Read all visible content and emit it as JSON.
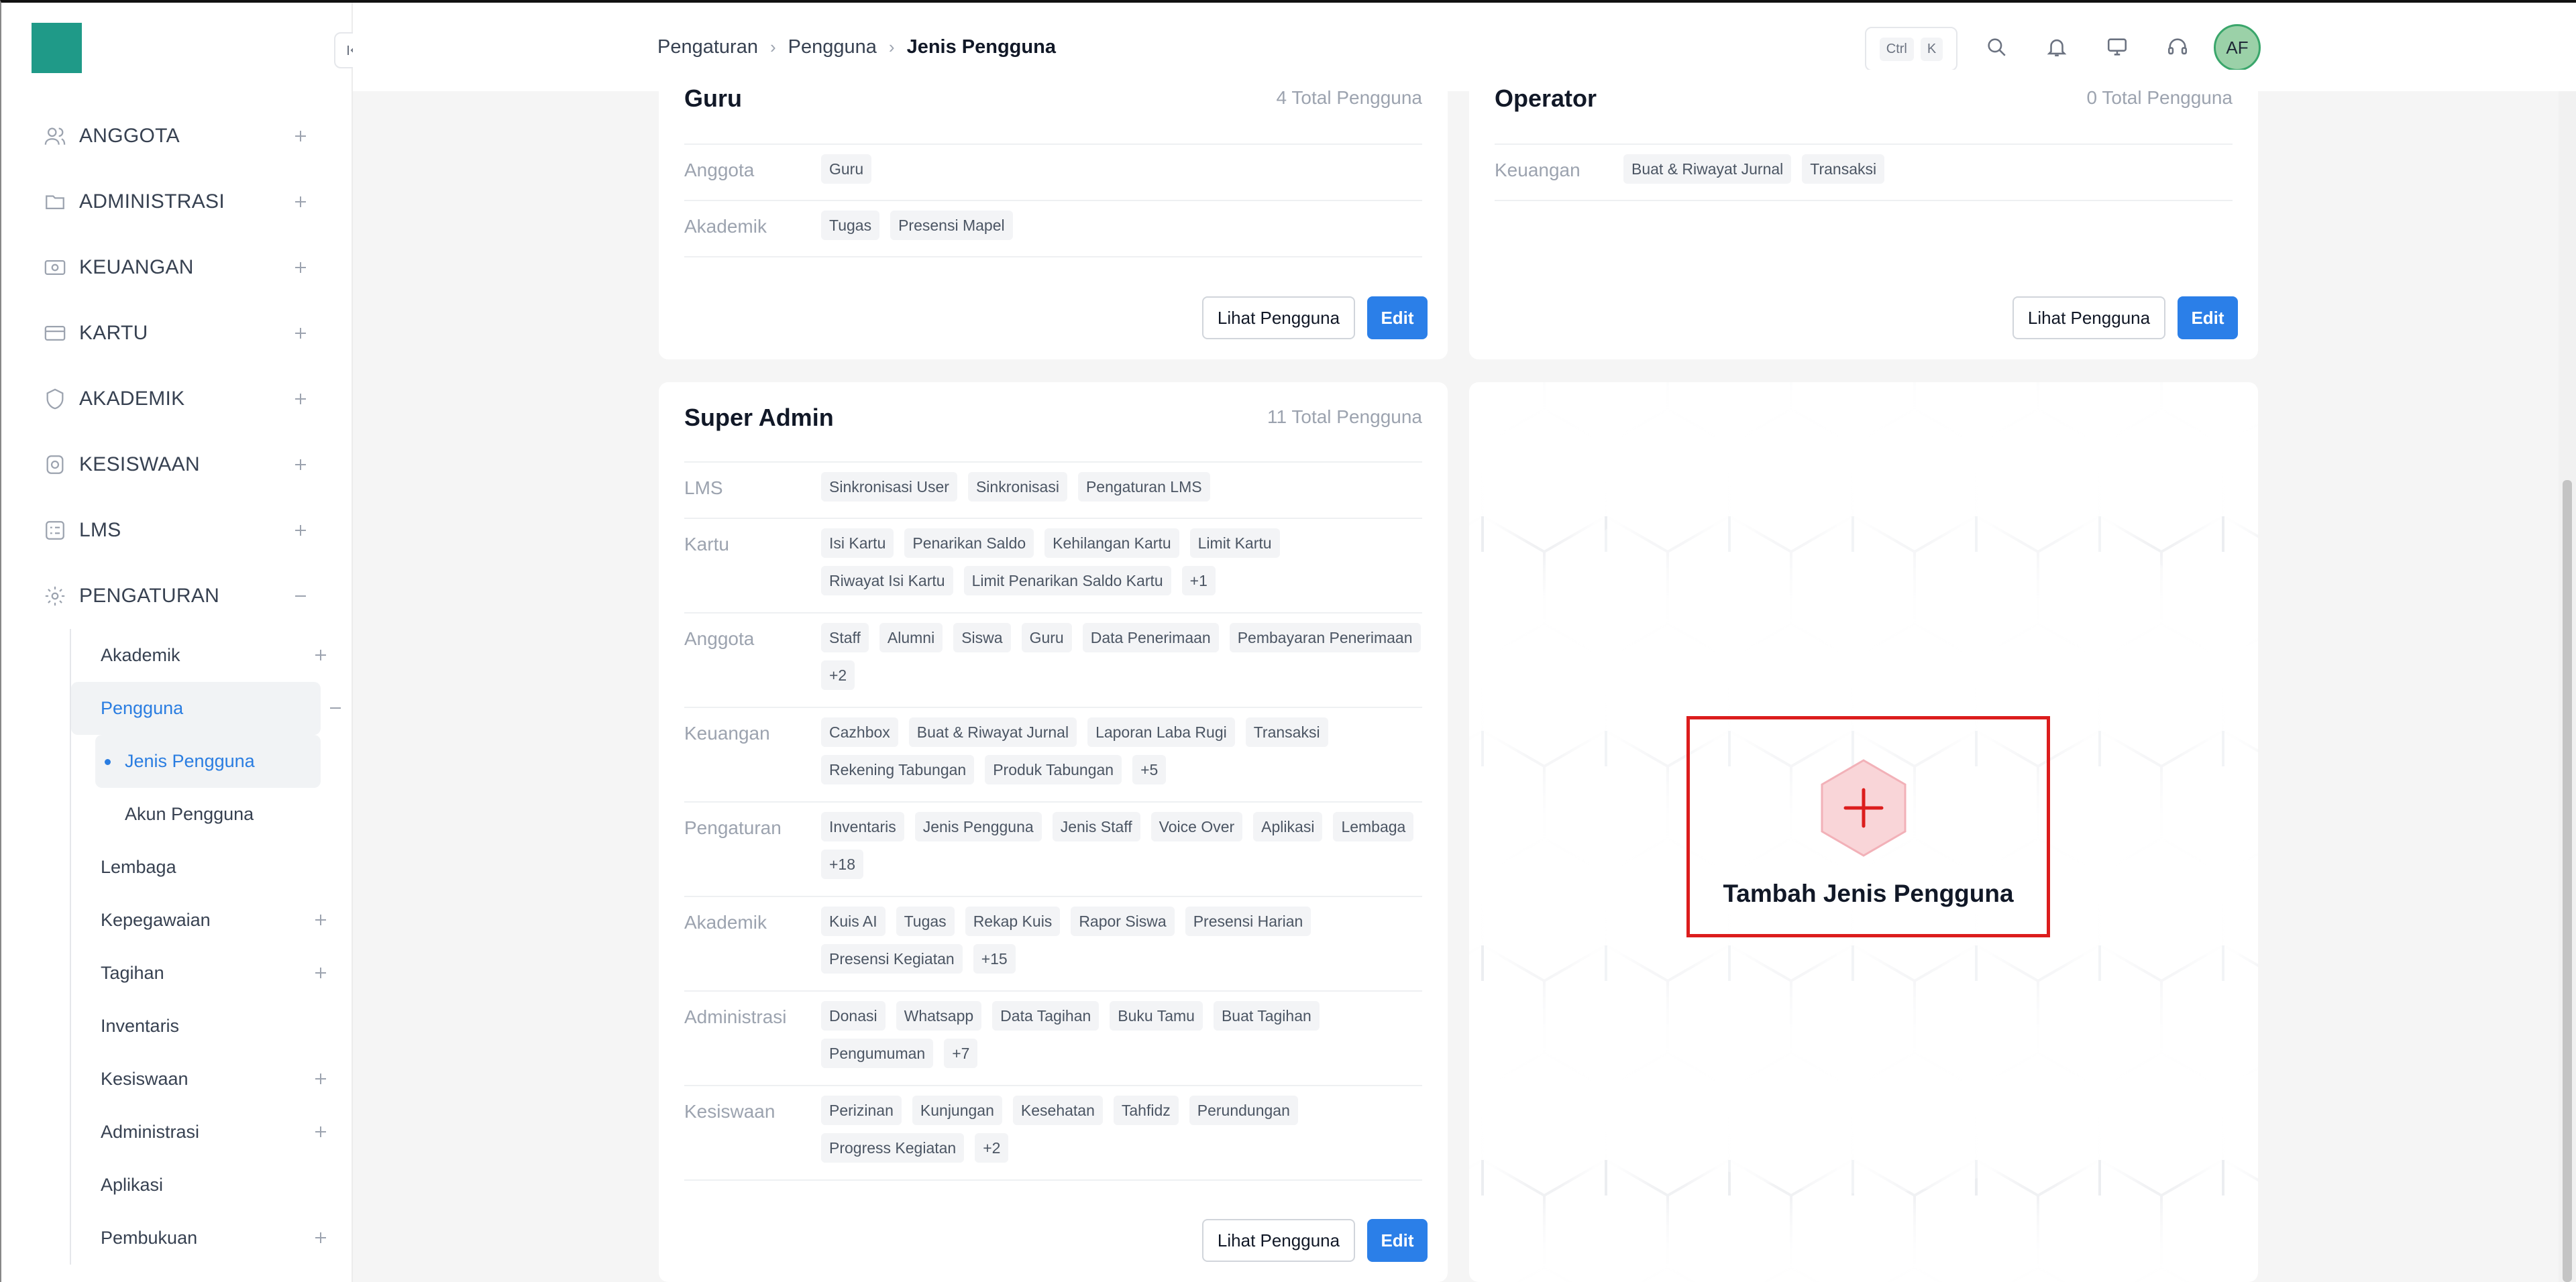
{
  "sidebar": {
    "items": [
      {
        "label": "ANGGOTA",
        "icon": "users-icon"
      },
      {
        "label": "ADMINISTRASI",
        "icon": "folder-icon"
      },
      {
        "label": "KEUANGAN",
        "icon": "money-icon"
      },
      {
        "label": "KARTU",
        "icon": "card-icon"
      },
      {
        "label": "AKADEMIK",
        "icon": "badge-icon"
      },
      {
        "label": "KESISWAAN",
        "icon": "student-icon"
      },
      {
        "label": "LMS",
        "icon": "checklist-icon"
      },
      {
        "label": "PENGATURAN",
        "icon": "gear-icon"
      }
    ],
    "pengaturan_sub": {
      "akademik": "Akademik",
      "pengguna": "Pengguna",
      "jenis_pengguna": "Jenis Pengguna",
      "akun_pengguna": "Akun Pengguna",
      "lembaga": "Lembaga",
      "kepegawaian": "Kepegawaian",
      "tagihan": "Tagihan",
      "inventaris": "Inventaris",
      "kesiswaan": "Kesiswaan",
      "administrasi": "Administrasi",
      "aplikasi": "Aplikasi",
      "pembukuan": "Pembukuan"
    }
  },
  "header": {
    "breadcrumb": [
      "Pengaturan",
      "Pengguna",
      "Jenis Pengguna"
    ],
    "kbd_ctrl": "Ctrl",
    "kbd_k": "K",
    "avatar": "AF"
  },
  "cards": {
    "guru": {
      "title": "Guru",
      "count": "4 Total Pengguna",
      "rows": [
        {
          "label": "Anggota",
          "chips": [
            "Guru"
          ]
        },
        {
          "label": "Akademik",
          "chips": [
            "Tugas",
            "Presensi Mapel"
          ]
        }
      ]
    },
    "operator": {
      "title": "Operator",
      "count": "0 Total Pengguna",
      "rows": [
        {
          "label": "Keuangan",
          "chips": [
            "Buat & Riwayat Jurnal",
            "Transaksi"
          ]
        }
      ]
    },
    "super_admin": {
      "title": "Super Admin",
      "count": "11 Total Pengguna",
      "rows": [
        {
          "label": "LMS",
          "chips": [
            "Sinkronisasi User",
            "Sinkronisasi",
            "Pengaturan LMS"
          ]
        },
        {
          "label": "Kartu",
          "chips": [
            "Isi Kartu",
            "Penarikan Saldo",
            "Kehilangan Kartu",
            "Limit Kartu",
            "Riwayat Isi Kartu",
            "Limit Penarikan Saldo Kartu",
            "+1"
          ]
        },
        {
          "label": "Anggota",
          "chips": [
            "Staff",
            "Alumni",
            "Siswa",
            "Guru",
            "Data Penerimaan",
            "Pembayaran Penerimaan",
            "+2"
          ]
        },
        {
          "label": "Keuangan",
          "chips": [
            "Cazhbox",
            "Buat & Riwayat Jurnal",
            "Laporan Laba Rugi",
            "Transaksi",
            "Rekening Tabungan",
            "Produk Tabungan",
            "+5"
          ]
        },
        {
          "label": "Pengaturan",
          "chips": [
            "Inventaris",
            "Jenis Pengguna",
            "Jenis Staff",
            "Voice Over",
            "Aplikasi",
            "Lembaga",
            "+18"
          ]
        },
        {
          "label": "Akademik",
          "chips": [
            "Kuis AI",
            "Tugas",
            "Rekap Kuis",
            "Rapor Siswa",
            "Presensi Harian",
            "Presensi Kegiatan",
            "+15"
          ]
        },
        {
          "label": "Administrasi",
          "chips": [
            "Donasi",
            "Whatsapp",
            "Data Tagihan",
            "Buku Tamu",
            "Buat Tagihan",
            "Pengumuman",
            "+7"
          ]
        },
        {
          "label": "Kesiswaan",
          "chips": [
            "Perizinan",
            "Kunjungan",
            "Kesehatan",
            "Tahfidz",
            "Perundungan",
            "Progress Kegiatan",
            "+2"
          ]
        }
      ]
    },
    "buttons": {
      "view": "Lihat Pengguna",
      "edit": "Edit"
    },
    "add": {
      "label": "Tambah Jenis Pengguna",
      "icon": "plus-icon",
      "accent": "#dc1d1d"
    }
  },
  "colors": {
    "primary": "#2b7fe8",
    "brand": "#1f9a88",
    "active": "#2a7de1"
  }
}
